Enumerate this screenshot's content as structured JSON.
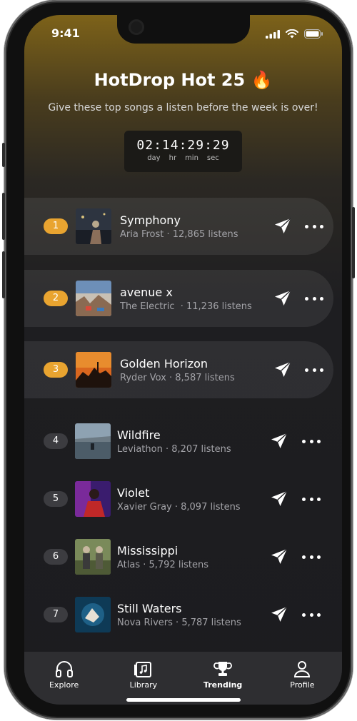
{
  "status_bar": {
    "time": "9:41"
  },
  "header": {
    "title": "HotDrop Hot 25 🔥",
    "subtitle": "Give these top songs a listen before the week is over!"
  },
  "countdown": {
    "value": "02:14:29:29",
    "units": [
      "day",
      "hr",
      "min",
      "sec"
    ]
  },
  "songs": [
    {
      "rank": "1",
      "title": "Symphony",
      "meta": "Aria Frost · 12,865 listens"
    },
    {
      "rank": "2",
      "title": "avenue x",
      "meta": "The Electric  · 11,236 listens"
    },
    {
      "rank": "3",
      "title": "Golden Horizon",
      "meta": "Ryder Vox · 8,587 listens"
    },
    {
      "rank": "4",
      "title": "Wildfire",
      "meta": "Leviathon · 8,207 listens"
    },
    {
      "rank": "5",
      "title": "Violet",
      "meta": "Xavier Gray · 8,097 listens"
    },
    {
      "rank": "6",
      "title": "Mississippi",
      "meta": "Atlas · 5,792 listens"
    },
    {
      "rank": "7",
      "title": "Still Waters",
      "meta": "Nova Rivers · 5,787 listens"
    }
  ],
  "tabs": [
    {
      "label": "Explore",
      "icon": "headphones-icon"
    },
    {
      "label": "Library",
      "icon": "music-library-icon"
    },
    {
      "label": "Trending",
      "icon": "trophy-icon",
      "active": true
    },
    {
      "label": "Profile",
      "icon": "person-icon"
    }
  ],
  "colors": {
    "accent_gold": "#e9a430",
    "background": "#1c1c1f",
    "tabbar": "#2e2e31"
  }
}
